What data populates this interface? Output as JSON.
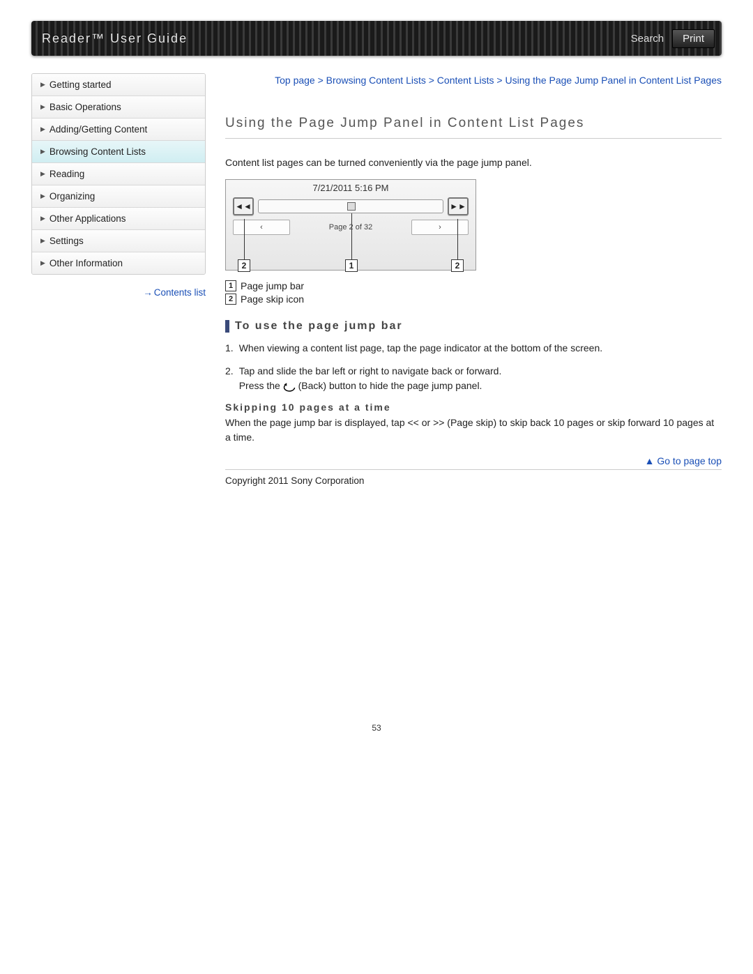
{
  "header": {
    "title": "Reader™ User Guide",
    "search_label": "Search",
    "print_label": "Print"
  },
  "sidebar": {
    "items": [
      {
        "label": "Getting started",
        "active": false
      },
      {
        "label": "Basic Operations",
        "active": false
      },
      {
        "label": "Adding/Getting Content",
        "active": false
      },
      {
        "label": "Browsing Content Lists",
        "active": true
      },
      {
        "label": "Reading",
        "active": false
      },
      {
        "label": "Organizing",
        "active": false
      },
      {
        "label": "Other Applications",
        "active": false
      },
      {
        "label": "Settings",
        "active": false
      },
      {
        "label": "Other Information",
        "active": false
      }
    ],
    "contents_list_label": "Contents list"
  },
  "breadcrumb": "Top page > Browsing Content Lists > Content Lists > Using the Page Jump Panel in Content List Pages",
  "page_heading": "Using the Page Jump Panel in Content List Pages",
  "intro_text": "Content list pages can be turned conveniently via the page jump panel.",
  "screenshot": {
    "timestamp": "7/21/2011 5:16 PM",
    "skip_back": "◄◄",
    "skip_fwd": "►►",
    "prev": "‹",
    "next": "›",
    "page_label": "Page 2 of 32",
    "callout_center": "1",
    "callout_left": "2",
    "callout_right": "2"
  },
  "legend": {
    "item1_num": "1",
    "item1_label": "Page jump bar",
    "item2_num": "2",
    "item2_label": "Page skip icon"
  },
  "section": {
    "heading": "To use the page jump bar",
    "step1_num": "1.",
    "step1_text": "When viewing a content list page, tap the page indicator at the bottom of the screen.",
    "step2_num": "2.",
    "step2_text_a": "Tap and slide the bar left or right to navigate back or forward.",
    "step2_text_b_pre": "Press the ",
    "step2_text_b_post": " (Back) button to hide the page jump panel.",
    "sub_heading": "Skipping 10 pages at a time",
    "sub_text": "When the page jump bar is displayed, tap << or >> (Page skip) to skip back 10 pages or skip forward 10 pages at a time."
  },
  "go_top_label": "Go to page top",
  "copyright": "Copyright 2011 Sony Corporation",
  "page_number": "53"
}
